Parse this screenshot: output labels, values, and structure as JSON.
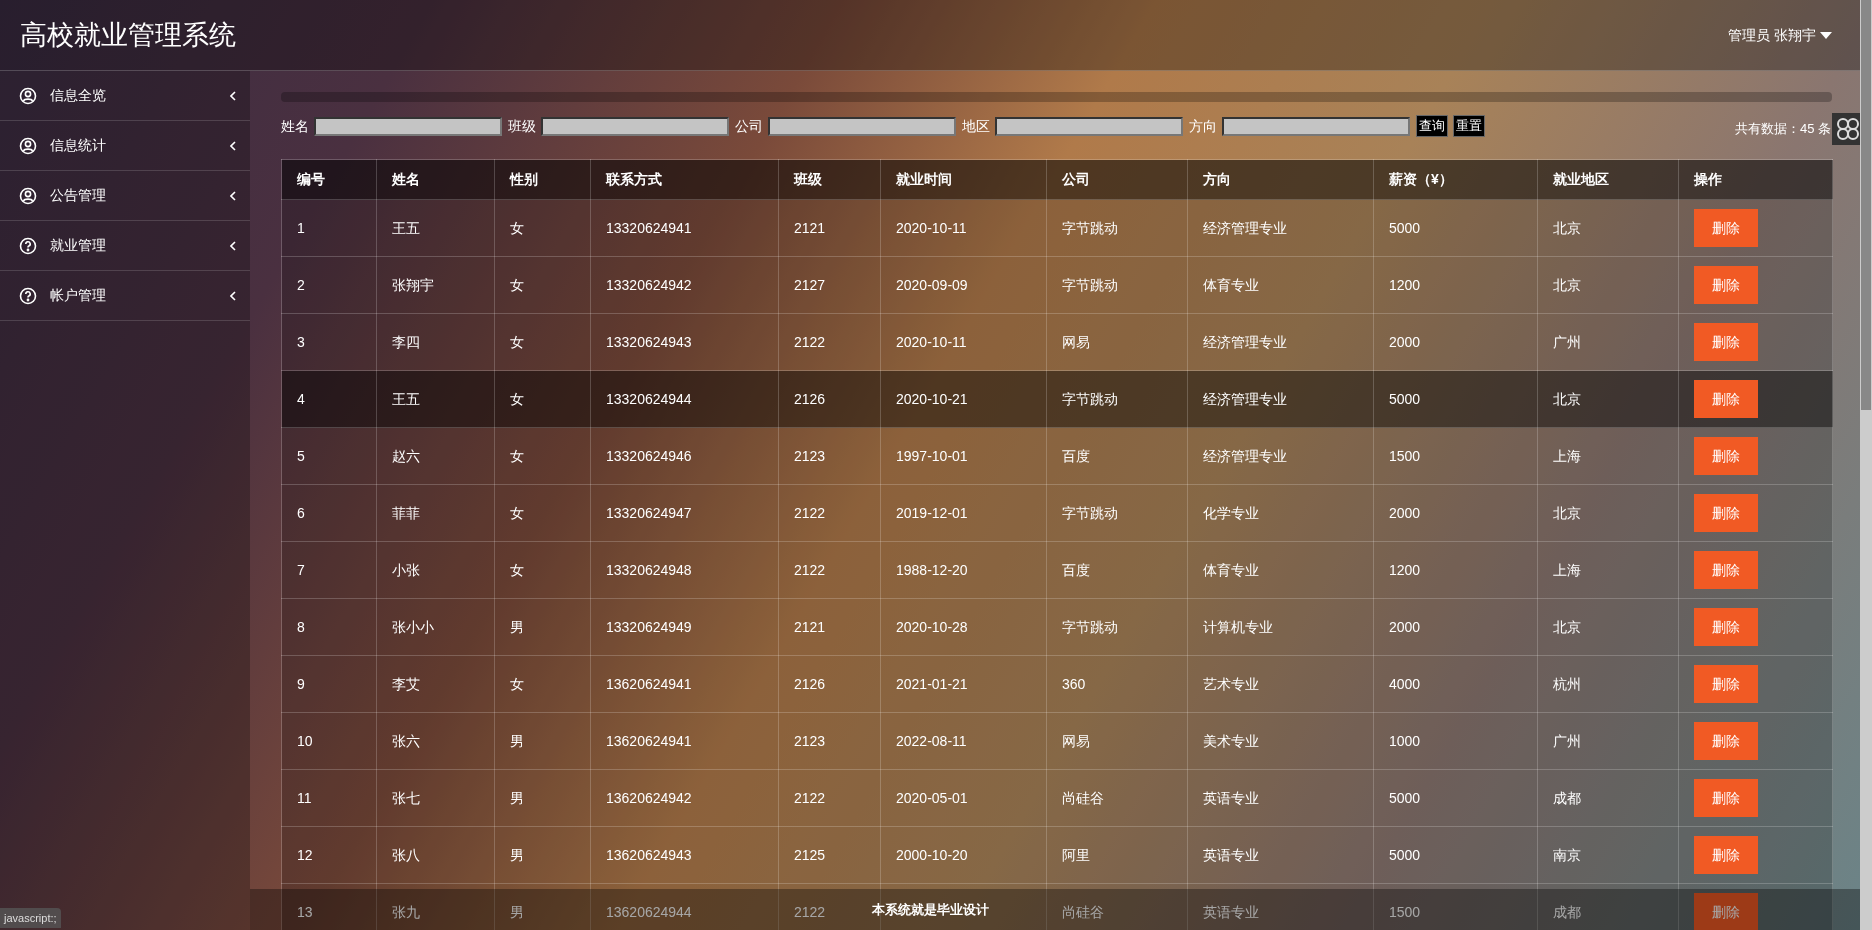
{
  "app_title": "高校就业管理系统",
  "user_menu": {
    "label": "管理员 张翔宇"
  },
  "sidebar": {
    "items": [
      {
        "label": "信息全览",
        "kind": "user"
      },
      {
        "label": "信息统计",
        "kind": "user"
      },
      {
        "label": "公告管理",
        "kind": "user"
      },
      {
        "label": "就业管理",
        "kind": "help"
      },
      {
        "label": "帐户管理",
        "kind": "help"
      }
    ]
  },
  "filters": [
    {
      "label": "姓名"
    },
    {
      "label": "班级"
    },
    {
      "label": "公司"
    },
    {
      "label": "地区"
    },
    {
      "label": "方向"
    }
  ],
  "filter_buttons": [
    "查询",
    "重置"
  ],
  "total": "共有数据：45 条",
  "table": {
    "columns": [
      "编号",
      "姓名",
      "性别",
      "联系方式",
      "班级",
      "就业时间",
      "公司",
      "方向",
      "薪资（¥）",
      "就业地区",
      "操作"
    ],
    "rows": [
      {
        "highlighted": false,
        "cells": [
          "1",
          "王五",
          "女",
          "13320624941",
          "2121",
          "2020-10-11",
          "字节跳动",
          "经济管理专业",
          "5000",
          "北京"
        ],
        "action": "删除"
      },
      {
        "highlighted": false,
        "cells": [
          "2",
          "张翔宇",
          "女",
          "13320624942",
          "2127",
          "2020-09-09",
          "字节跳动",
          "体育专业",
          "1200",
          "北京"
        ],
        "action": "删除"
      },
      {
        "highlighted": false,
        "cells": [
          "3",
          "李四",
          "女",
          "13320624943",
          "2122",
          "2020-10-11",
          "网易",
          "经济管理专业",
          "2000",
          "广州"
        ],
        "action": "删除"
      },
      {
        "highlighted": true,
        "cells": [
          "4",
          "王五",
          "女",
          "13320624944",
          "2126",
          "2020-10-21",
          "字节跳动",
          "经济管理专业",
          "5000",
          "北京"
        ],
        "action": "删除"
      },
      {
        "highlighted": false,
        "cells": [
          "5",
          "赵六",
          "女",
          "13320624946",
          "2123",
          "1997-10-01",
          "百度",
          "经济管理专业",
          "1500",
          "上海"
        ],
        "action": "删除"
      },
      {
        "highlighted": false,
        "cells": [
          "6",
          "菲菲",
          "女",
          "13320624947",
          "2122",
          "2019-12-01",
          "字节跳动",
          "化学专业",
          "2000",
          "北京"
        ],
        "action": "删除"
      },
      {
        "highlighted": false,
        "cells": [
          "7",
          "小张",
          "女",
          "13320624948",
          "2122",
          "1988-12-20",
          "百度",
          "体育专业",
          "1200",
          "上海"
        ],
        "action": "删除"
      },
      {
        "highlighted": false,
        "cells": [
          "8",
          "张小小",
          "男",
          "13320624949",
          "2121",
          "2020-10-28",
          "字节跳动",
          "计算机专业",
          "2000",
          "北京"
        ],
        "action": "删除"
      },
      {
        "highlighted": false,
        "cells": [
          "9",
          "李艾",
          "女",
          "13620624941",
          "2126",
          "2021-01-21",
          "360",
          "艺术专业",
          "4000",
          "杭州"
        ],
        "action": "删除"
      },
      {
        "highlighted": false,
        "cells": [
          "10",
          "张六",
          "男",
          "13620624941",
          "2123",
          "2022-08-11",
          "网易",
          "美术专业",
          "1000",
          "广州"
        ],
        "action": "删除"
      },
      {
        "highlighted": false,
        "cells": [
          "11",
          "张七",
          "男",
          "13620624942",
          "2122",
          "2020-05-01",
          "尚硅谷",
          "英语专业",
          "5000",
          "成都"
        ],
        "action": "删除"
      },
      {
        "highlighted": false,
        "cells": [
          "12",
          "张八",
          "男",
          "13620624943",
          "2125",
          "2000-10-20",
          "阿里",
          "英语专业",
          "5000",
          "南京"
        ],
        "action": "删除"
      },
      {
        "highlighted": false,
        "cells": [
          "13",
          "张九",
          "男",
          "13620624944",
          "2122",
          null,
          "尚硅谷",
          "英语专业",
          "1500",
          "成都"
        ],
        "action": "删除"
      }
    ]
  },
  "footer": "本系统就是毕业设计",
  "status_text": "javascript:;"
}
